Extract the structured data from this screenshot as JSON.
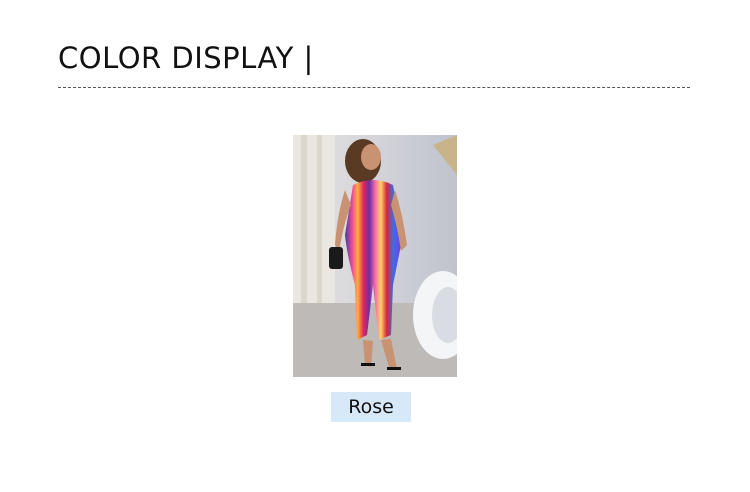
{
  "section": {
    "title": "COLOR DISPLAY |"
  },
  "swatches": [
    {
      "label": "Rose"
    }
  ]
}
